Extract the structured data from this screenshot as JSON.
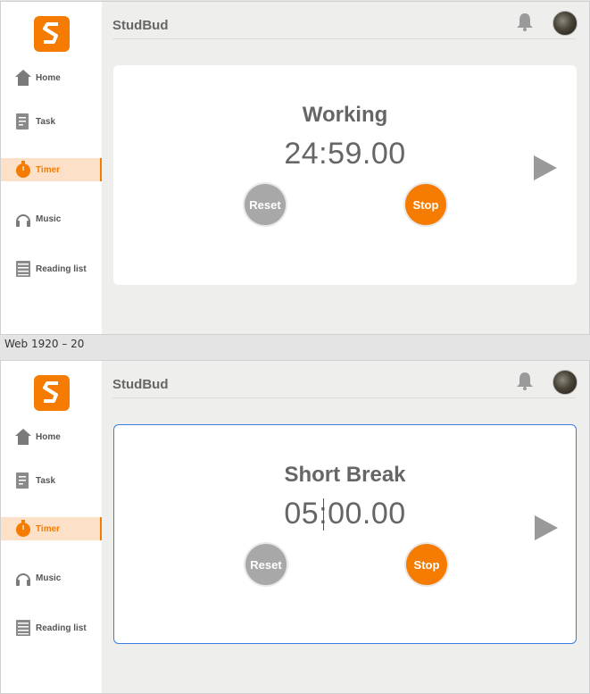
{
  "app": {
    "name": "StudBud"
  },
  "sidebar": {
    "items": [
      {
        "label": "Home",
        "icon": "home-icon"
      },
      {
        "label": "Task",
        "icon": "task-icon"
      },
      {
        "label": "Timer",
        "icon": "timer-icon",
        "active": true
      },
      {
        "label": "Music",
        "icon": "headphones-icon"
      },
      {
        "label": "Reading list",
        "icon": "list-icon"
      }
    ]
  },
  "frame_label": "Web 1920 – 20",
  "colors": {
    "accent": "#f57c00",
    "reset": "#a8a8a8",
    "text": "#666666",
    "focus": "#3b7ddd"
  },
  "screens": [
    {
      "mode": "Working",
      "time": "24:59.00",
      "reset_label": "Reset",
      "stop_label": "Stop"
    },
    {
      "mode": "Short Break",
      "time": "05:00.00",
      "reset_label": "Reset",
      "stop_label": "Stop"
    }
  ]
}
